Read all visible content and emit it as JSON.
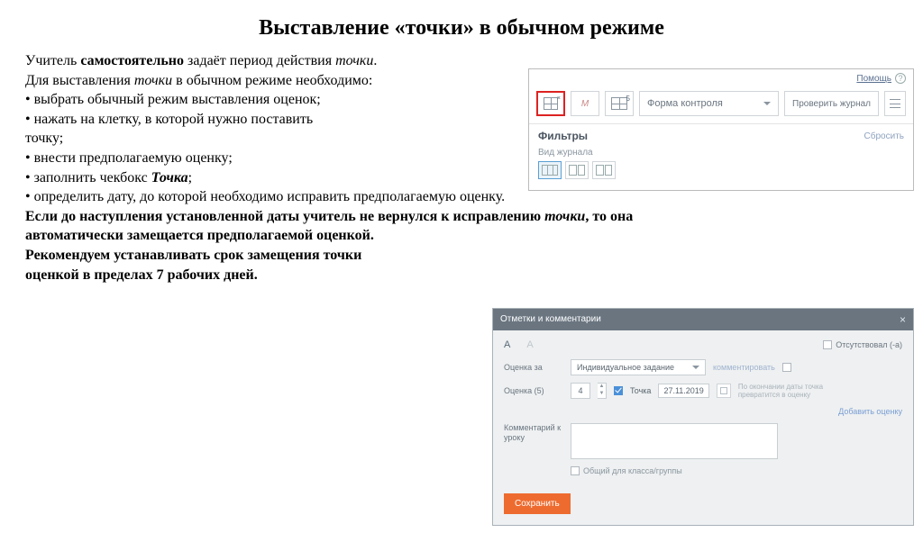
{
  "title": "Выставление «точки» в обычном режиме",
  "intro": {
    "l1a": "Учитель ",
    "l1b": "самостоятельно",
    "l1c": " задаёт период действия ",
    "l1d": "точки",
    "l1e": ".",
    "l2a": "Для выставления ",
    "l2b": "точки",
    "l2c": " в обычном режиме необходимо:",
    "b1": "•  выбрать обычный режим выставления оценок;",
    "b2a": "•  нажать на клетку, в которой нужно поставить",
    "b2b": "точку;",
    "b3": "•  внести предполагаемую оценку;",
    "b4a": "•  заполнить чекбокс  ",
    "b4b": "Точка",
    "b4c": ";",
    "b5": "•  определить дату, до которой необходимо исправить предполагаемую оценку.",
    "s1a": "Если до наступления установленной даты учитель не вернулся к исправлению ",
    "s1b": "точки",
    "s1c": ", то она",
    "s2": "автоматически замещается предполагаемой оценкой.",
    "rec1": "Рекомендуем устанавливать срок замещения точки",
    "rec2": "оценкой в пределах 7 рабочих дней."
  },
  "panel": {
    "help": "Помощь",
    "form_control": "Форма контроля",
    "check_journal": "Проверить журнал",
    "filters": "Фильтры",
    "reset": "Сбросить",
    "view_label": "Вид журнала",
    "icon5": "5"
  },
  "dialog": {
    "header": "Отметки и комментарии",
    "tab_a": "А",
    "tab_a2": "А",
    "absent": "Отсутствовал (-а)",
    "grade_for": "Оценка за",
    "task_type": "Индивидуальное задание",
    "comment_action": "комментировать",
    "grade5": "Оценка (5)",
    "grade_val": "4",
    "tochka": "Точка",
    "date": "27.11.2019",
    "hint": "По окончании даты точка превратится в оценку",
    "add_grade": "Добавить оценку",
    "comment_lesson": "Комментарий к уроку",
    "class_common": "Общий для класса/группы",
    "save": "Сохранить"
  }
}
